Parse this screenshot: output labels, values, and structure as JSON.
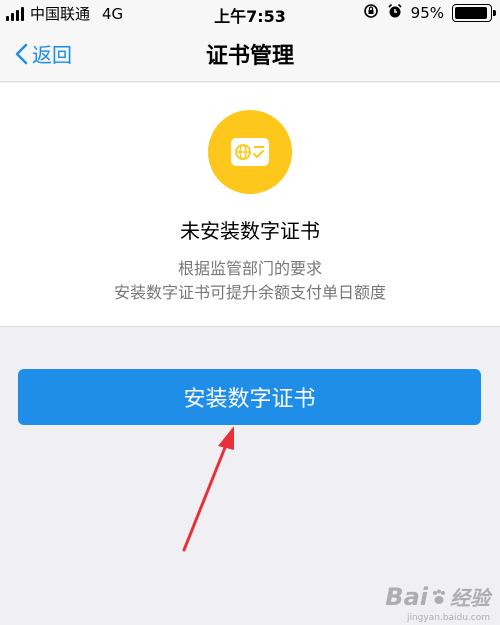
{
  "status_bar": {
    "carrier": "中国联通",
    "network": "4G",
    "time": "上午7:53",
    "battery": "95%",
    "battery_level": 0.95
  },
  "nav": {
    "back_label": "返回",
    "title": "证书管理"
  },
  "card": {
    "icon": "certificate-icon",
    "title": "未安装数字证书",
    "desc_line1": "根据监管部门的要求",
    "desc_line2": "安装数字证书可提升余额支付单日额度"
  },
  "install_button_label": "安装数字证书",
  "colors": {
    "accent": "#1e8ee8",
    "badge": "#fec71b",
    "annotation_arrow": "#e8303a"
  },
  "watermark": {
    "brand": "Bai",
    "suffix": "经验",
    "url": "jingyan.baidu.com"
  }
}
